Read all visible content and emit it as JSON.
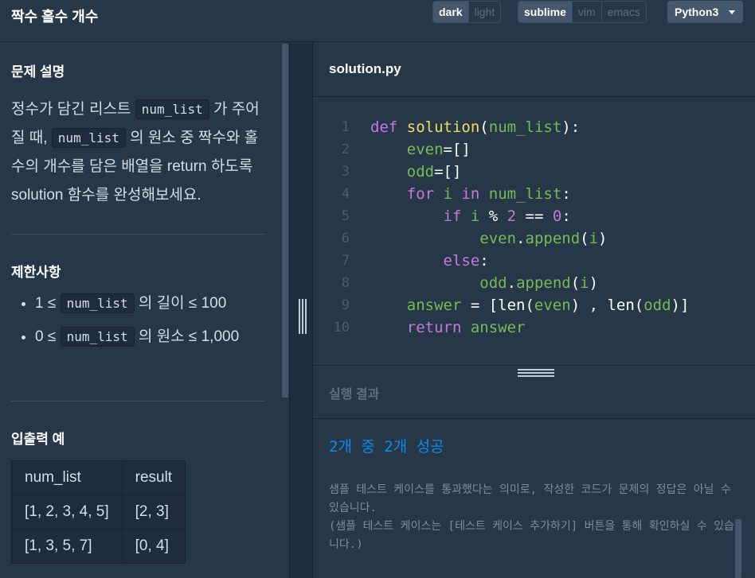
{
  "header": {
    "title": "짝수 홀수 개수",
    "theme_options": [
      {
        "label": "dark",
        "active": true
      },
      {
        "label": "light",
        "active": false
      }
    ],
    "keymap_options": [
      {
        "label": "sublime",
        "active": true
      },
      {
        "label": "vim",
        "active": false
      },
      {
        "label": "emacs",
        "active": false
      }
    ],
    "language": "Python3"
  },
  "problem": {
    "section_title": "문제 설명",
    "desc_1": "정수가 담긴 리스트 ",
    "desc_code_1": "num_list",
    "desc_2": " 가 주어질 때, ",
    "desc_code_2": "num_list",
    "desc_3": " 의 원소 중 짝수와 홀수의 개수를 담은 배열을 return 하도록 solution 함수를 완성해보세요.",
    "constraints_title": "제한사항",
    "constraints": [
      {
        "prefix": "1 ≤ ",
        "code": "num_list",
        "suffix": " 의 길이 ≤ 100"
      },
      {
        "prefix": "0 ≤ ",
        "code": "num_list",
        "suffix": " 의 원소 ≤ 1,000"
      }
    ],
    "examples_title": "입출력 예",
    "examples": {
      "headers": [
        "num_list",
        "result"
      ],
      "rows": [
        [
          "[1, 2, 3, 4, 5]",
          "[2, 3]"
        ],
        [
          "[1, 3, 5, 7]",
          "[0, 4]"
        ]
      ]
    }
  },
  "editor": {
    "filename": "solution.py",
    "line_numbers": [
      "1",
      "2",
      "3",
      "4",
      "5",
      "6",
      "7",
      "8",
      "9",
      "10"
    ]
  },
  "result": {
    "title": "실행 결과",
    "summary": "2개 중 2개 성공",
    "message": "샘플 테스트 케이스를 통과했다는 의미로, 작성한 코드가 문제의 정답은 아닐 수 있습니다.",
    "message_2": "(샘플 테스트 케이스는 [테스트 케이스 추가하기] 버튼을 통해 확인하실 수 있습니다.)"
  },
  "colors": {
    "background": "#263747",
    "success": "#0c8ce9",
    "keyword": "#c678dd",
    "function": "#f4d96b",
    "variable": "#78b958"
  }
}
